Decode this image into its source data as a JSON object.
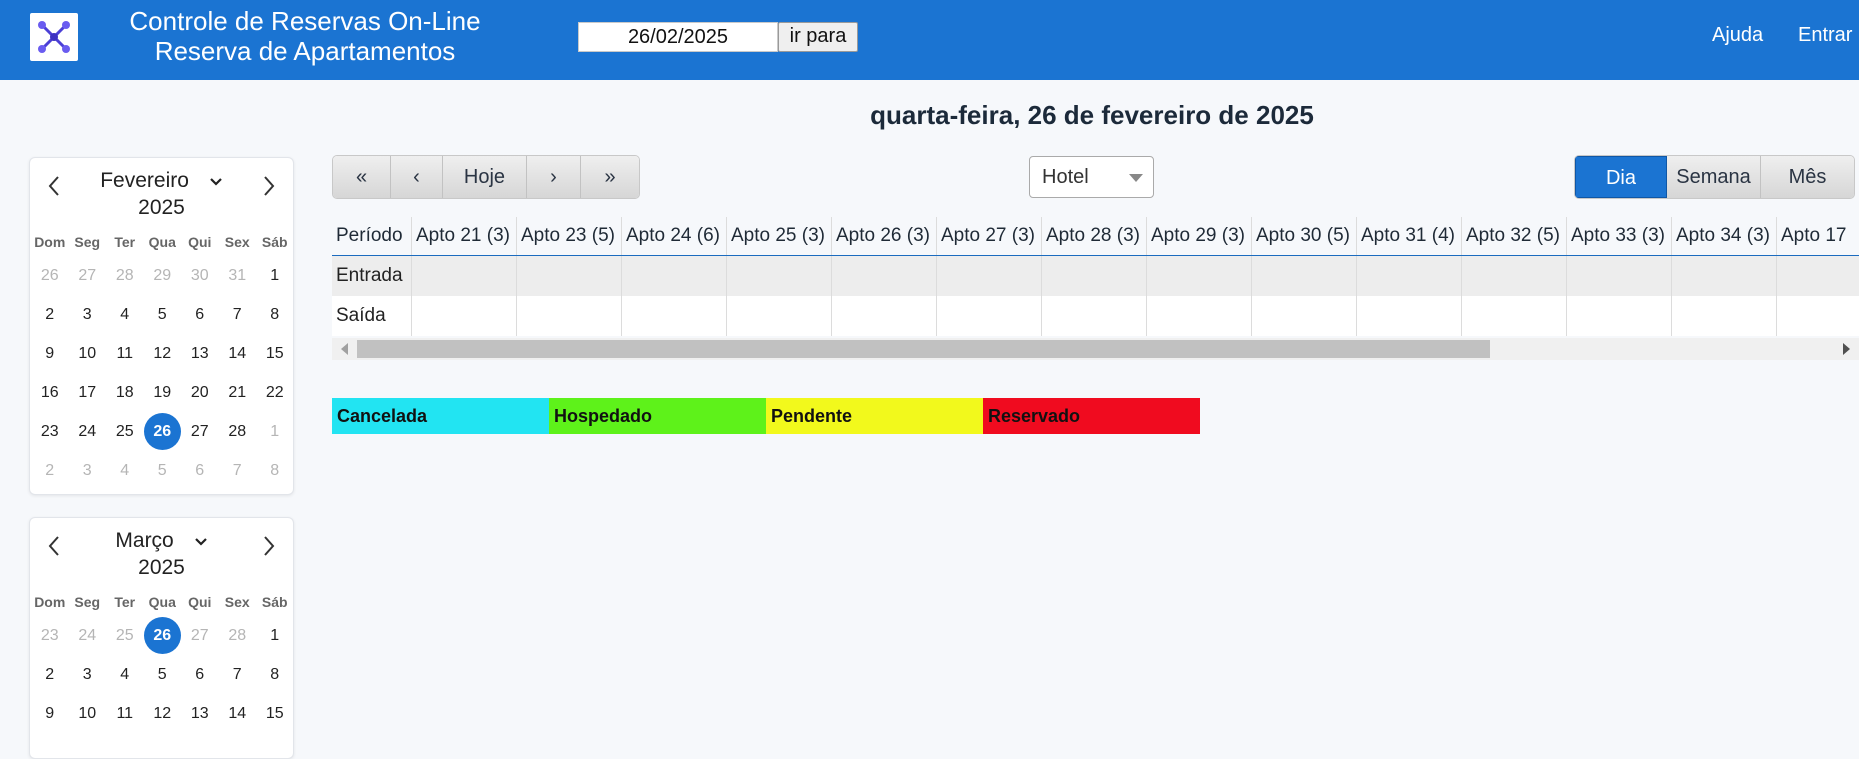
{
  "header": {
    "title_line1": "Controle de Reservas On-Line",
    "title_line2": "Reserva de Apartamentos",
    "date_value": "26/02/2025",
    "goto_label": "ir para",
    "help_label": "Ajuda",
    "login_label": "Entrar",
    "logo_icon": "network-logo-icon"
  },
  "main": {
    "day_title": "quarta-feira, 26 de fevereiro de 2025"
  },
  "toolbar": {
    "first_label": "«",
    "prev_label": "‹",
    "today_label": "Hoje",
    "next_label": "›",
    "last_label": "»",
    "resource_select": "Hotel",
    "views": [
      {
        "label": "Dia",
        "active": true
      },
      {
        "label": "Semana",
        "active": false
      },
      {
        "label": "Mês",
        "active": false
      }
    ]
  },
  "calendars": {
    "dow": [
      "Dom",
      "Seg",
      "Ter",
      "Qua",
      "Qui",
      "Sex",
      "Sáb"
    ],
    "months": [
      {
        "month": "Fevereiro",
        "year": "2025",
        "days": [
          {
            "d": "26",
            "o": true
          },
          {
            "d": "27",
            "o": true
          },
          {
            "d": "28",
            "o": true
          },
          {
            "d": "29",
            "o": true
          },
          {
            "d": "30",
            "o": true
          },
          {
            "d": "31",
            "o": true
          },
          {
            "d": "1"
          },
          {
            "d": "2"
          },
          {
            "d": "3"
          },
          {
            "d": "4"
          },
          {
            "d": "5"
          },
          {
            "d": "6"
          },
          {
            "d": "7"
          },
          {
            "d": "8"
          },
          {
            "d": "9"
          },
          {
            "d": "10"
          },
          {
            "d": "11"
          },
          {
            "d": "12"
          },
          {
            "d": "13"
          },
          {
            "d": "14"
          },
          {
            "d": "15"
          },
          {
            "d": "16"
          },
          {
            "d": "17"
          },
          {
            "d": "18"
          },
          {
            "d": "19"
          },
          {
            "d": "20"
          },
          {
            "d": "21"
          },
          {
            "d": "22"
          },
          {
            "d": "23"
          },
          {
            "d": "24"
          },
          {
            "d": "25"
          },
          {
            "d": "26",
            "sel": true
          },
          {
            "d": "27"
          },
          {
            "d": "28"
          },
          {
            "d": "1",
            "o": true
          },
          {
            "d": "2",
            "o": true
          },
          {
            "d": "3",
            "o": true
          },
          {
            "d": "4",
            "o": true
          },
          {
            "d": "5",
            "o": true
          },
          {
            "d": "6",
            "o": true
          },
          {
            "d": "7",
            "o": true
          },
          {
            "d": "8",
            "o": true
          }
        ]
      },
      {
        "month": "Março",
        "year": "2025",
        "days": [
          {
            "d": "23",
            "o": true
          },
          {
            "d": "24",
            "o": true
          },
          {
            "d": "25",
            "o": true
          },
          {
            "d": "26",
            "sel": true
          },
          {
            "d": "27",
            "o": true
          },
          {
            "d": "28",
            "o": true
          },
          {
            "d": "1"
          },
          {
            "d": "2"
          },
          {
            "d": "3"
          },
          {
            "d": "4"
          },
          {
            "d": "5"
          },
          {
            "d": "6"
          },
          {
            "d": "7"
          },
          {
            "d": "8"
          },
          {
            "d": "9"
          },
          {
            "d": "10"
          },
          {
            "d": "11"
          },
          {
            "d": "12"
          },
          {
            "d": "13"
          },
          {
            "d": "14"
          },
          {
            "d": "15"
          }
        ]
      }
    ]
  },
  "schedule": {
    "period_header": "Período",
    "apartments": [
      "Apto 21 (3)",
      "Apto 23 (5)",
      "Apto 24 (6)",
      "Apto 25 (3)",
      "Apto 26 (3)",
      "Apto 27 (3)",
      "Apto 28 (3)",
      "Apto 29 (3)",
      "Apto 30 (5)",
      "Apto 31 (4)",
      "Apto 32 (5)",
      "Apto 33 (3)",
      "Apto 34 (3)",
      "Apto 17"
    ],
    "rows": [
      "Entrada",
      "Saída"
    ]
  },
  "legend": [
    {
      "label": "Cancelada",
      "color": "#22e4f2"
    },
    {
      "label": "Hospedado",
      "color": "#5ef21a"
    },
    {
      "label": "Pendente",
      "color": "#f2f91c"
    },
    {
      "label": "Reservado",
      "color": "#f00b1f"
    }
  ],
  "colors": {
    "brand": "#1b74d2"
  }
}
